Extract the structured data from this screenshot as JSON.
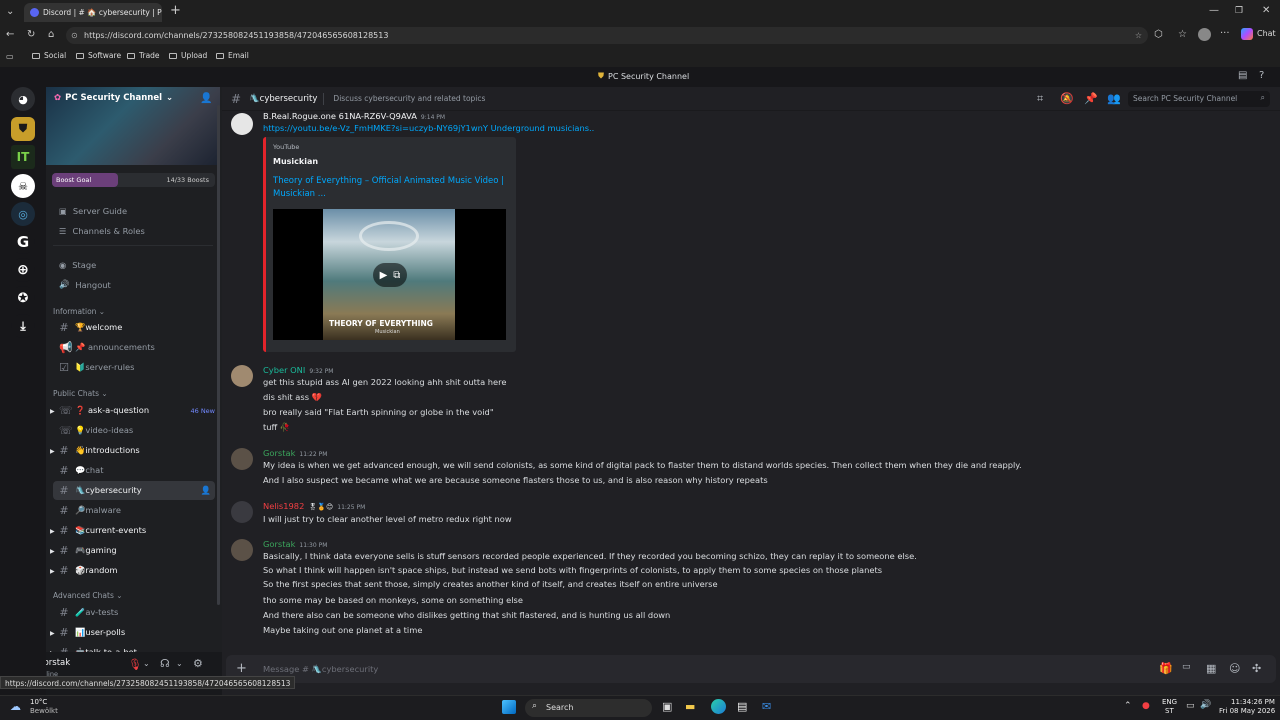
{
  "browser": {
    "tab_title": "Discord | # 🏠 cybersecurity | PC Se",
    "url": "https://discord.com/channels/273258082451193858/472046565608128513",
    "copilot": "Chat",
    "bookmarks": [
      "Social",
      "Software",
      "Trade",
      "Upload",
      "Email"
    ]
  },
  "window_title": "PC Security Channel",
  "server": {
    "name": "PC Security Channel",
    "boost_label": "Boost Goal",
    "boost_count": "14/33 Boosts"
  },
  "sidebar": {
    "top_items": [
      "Server Guide",
      "Channels & Roles",
      "Stage",
      "Hangout"
    ],
    "cat_info": "Information",
    "info": [
      "🏆welcome",
      "📌 announcements",
      "🔰server-rules"
    ],
    "cat_public": "Public Chats",
    "public": [
      "❓ ask-a-question",
      "💡video-ideas",
      "👋introductions",
      "💬chat",
      "🛝cybersecurity",
      "🔎malware",
      "📚current-events",
      "🎮gaming",
      "🎲random"
    ],
    "new_badge": "46 New",
    "cat_adv": "Advanced Chats",
    "adv": [
      "🧪av-tests",
      "📊user-polls",
      "🤖talk-to-a-bot"
    ]
  },
  "user": {
    "name": "Gorstak",
    "status": "Online"
  },
  "channel": {
    "name": "🛝cybersecurity",
    "topic": "Discuss cybersecurity and related topics",
    "search_placeholder": "Search PC Security Channel"
  },
  "messages": [
    {
      "author": "B.Real.Rogue.one 61NA-RZ6V-Q9AVA",
      "time": "9:14 PM",
      "lines": [
        "https://youtu.be/e-Vz_FmHMKE?si=uczyb-NY69jY1wnY  Underground musicians.."
      ]
    },
    {
      "author": "Cyber ONI",
      "time": "9:32 PM",
      "lines": [
        "get this stupid ass AI gen 2022 looking ahh shit outta here",
        "dis shit ass 💔",
        "bro really said \"Flat Earth spinning or globe in the void\"",
        "tuff 🥀"
      ]
    },
    {
      "author": "Gorstak",
      "time": "11:22 PM",
      "lines": [
        "My idea is when we get advanced enough, we will send colonists, as some kind of digital pack to flaster them to distand worlds species. Then collect them when they die and reapply.",
        "And I also suspect we became what we are because someone flasters those to us, and is also reason why history repeats"
      ]
    },
    {
      "author": "Nelis1982",
      "time": "11:25 PM",
      "lines": [
        "I will just try to clear another level of metro redux right now"
      ]
    },
    {
      "author": "Gorstak",
      "time": "11:30 PM",
      "lines": [
        "Basically, I think data everyone sells is stuff sensors recorded people experienced. If they recorded you becoming schizo, they can replay it to someone else.",
        "So what I think will happen isn't space ships, but instead we send bots with fingerprints of colonists, to apply them to some species on those planets",
        "So the first species that sent those, simply creates another kind of itself, and creates itself on entire universe",
        "tho some may be based on monkeys, some on something else",
        "And there also can be someone who dislikes getting that shit flastered, and is hunting us all down",
        "Maybe taking out one planet at a time"
      ]
    }
  ],
  "embed": {
    "provider": "YouTube",
    "author": "Musickian",
    "title": "Theory of Everything – Official Animated Music Video | Musickian ...",
    "thumb_text": "THEORY OF EVERYTHING",
    "thumb_sub": "Musickian"
  },
  "composer": {
    "placeholder": "Message # 🛝cybersecurity"
  },
  "status_url": "https://discord.com/channels/273258082451193858/472046565608128513",
  "taskbar": {
    "weather": "10°C",
    "weather_desc": "Bewölkt",
    "search": "Search",
    "lang": "ENG",
    "lang2": "ST",
    "time": "11:34:26 PM",
    "date": "Fri 08 May 2026"
  }
}
